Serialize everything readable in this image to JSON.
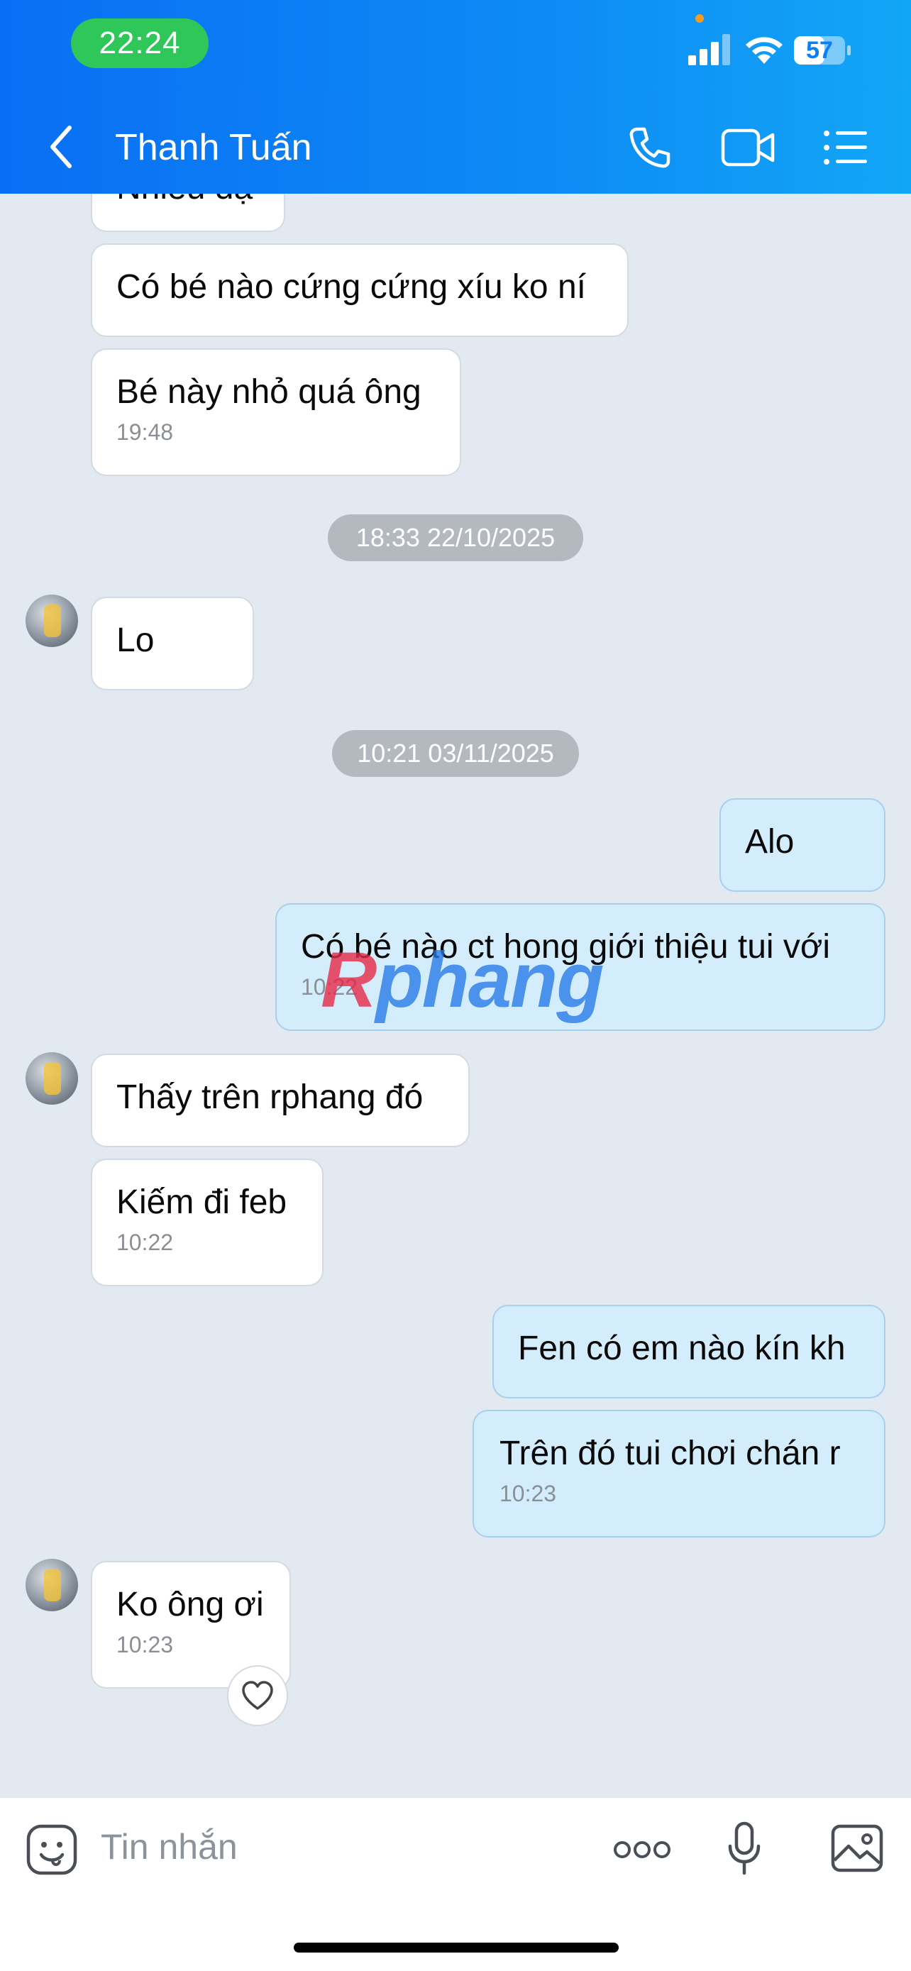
{
  "status_bar": {
    "time": "22:24",
    "battery": "57"
  },
  "header": {
    "contact_name": "Thanh Tuấn"
  },
  "messages": {
    "m0": {
      "text": "Nhiều dạ"
    },
    "m1": {
      "text": "Có bé nào cứng cứng xíu ko ní"
    },
    "m2": {
      "text": "Bé này nhỏ quá ông",
      "time": "19:48"
    },
    "sep1": "18:33 22/10/2025",
    "m3": {
      "text": "Lo"
    },
    "sep2": "10:21 03/11/2025",
    "m4": {
      "text": "Alo"
    },
    "m5": {
      "text": "Có bé nào ct hong giới thiệu tui với",
      "time": "10:22"
    },
    "m6": {
      "text": "Thấy trên rphang đó"
    },
    "m7": {
      "text": "Kiếm đi feb",
      "time": "10:22"
    },
    "m8": {
      "text": "Fen có em nào kín kh"
    },
    "m9": {
      "text": "Trên đó tui chơi chán r",
      "time": "10:23"
    },
    "m10": {
      "text": "Ko ông ơi",
      "time": "10:23"
    }
  },
  "watermark": {
    "part1": "R",
    "part2": "phang"
  },
  "input": {
    "placeholder": "Tin nhắn"
  }
}
